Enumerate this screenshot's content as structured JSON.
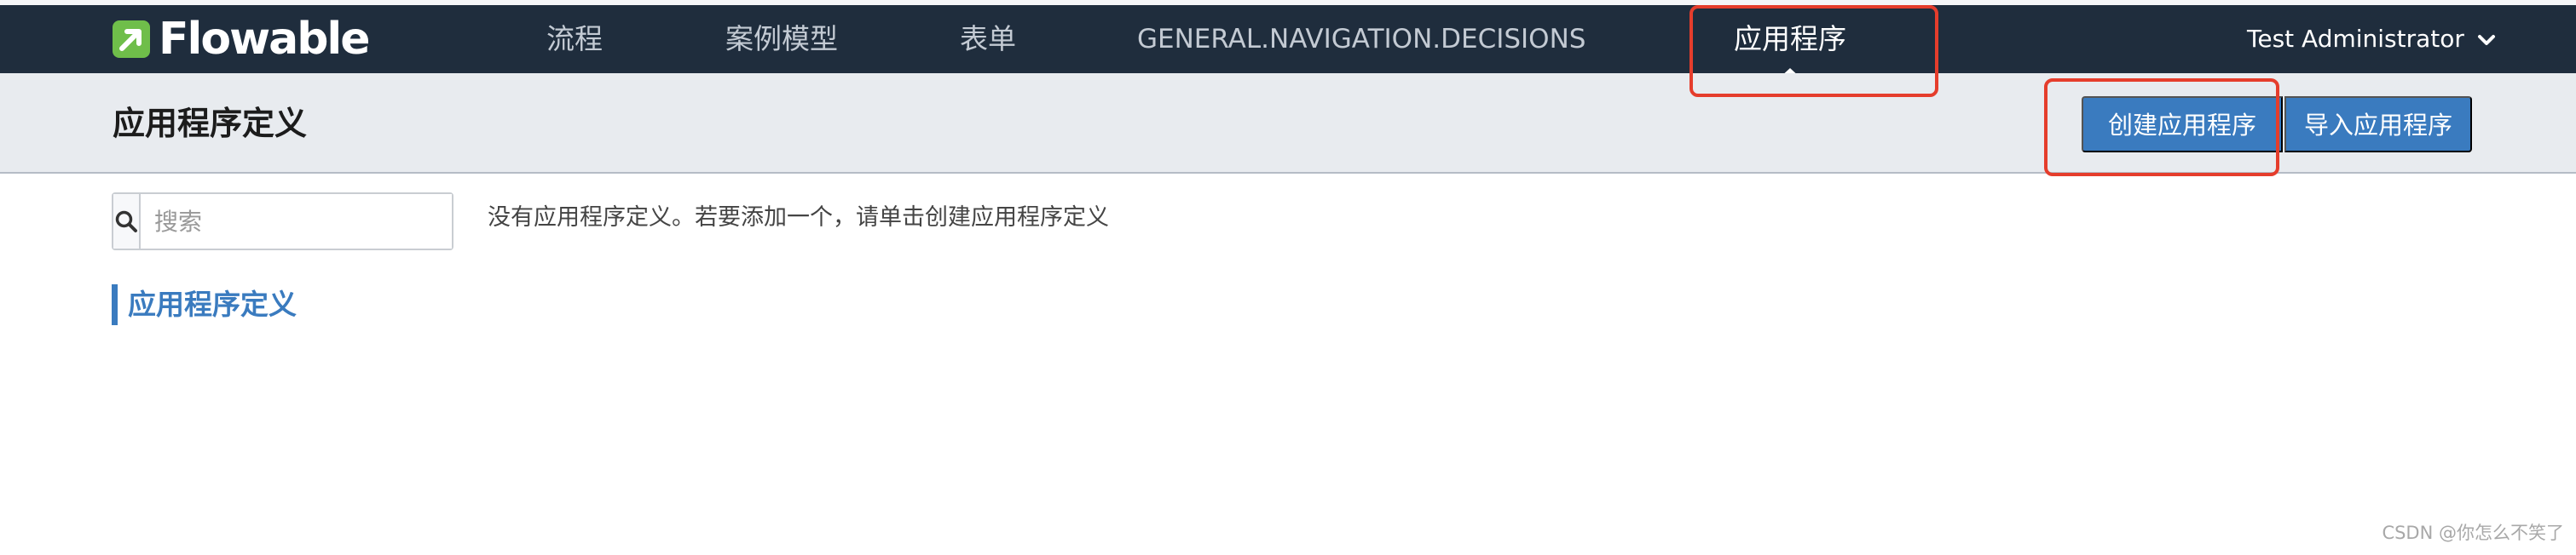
{
  "app": {
    "logo_text": "Flowable"
  },
  "nav": {
    "items": [
      {
        "label": "流程"
      },
      {
        "label": "案例模型"
      },
      {
        "label": "表单"
      },
      {
        "label": "GENERAL.NAVIGATION.DECISIONS"
      },
      {
        "label": "应用程序",
        "active": true
      }
    ],
    "user": "Test Administrator",
    "user_icon": "chevron-down-icon"
  },
  "subheader": {
    "title": "应用程序定义",
    "create_button": "创建应用程序",
    "import_button": "导入应用程序"
  },
  "search": {
    "placeholder": "搜索",
    "value": "",
    "icon": "search-icon"
  },
  "main": {
    "empty_message": "没有应用程序定义。若要添加一个，请单击创建应用程序定义",
    "section_title": "应用程序定义"
  },
  "annotations": {
    "color": "#e53d2c"
  },
  "colors": {
    "navbar": "#1f2d3d",
    "accent": "#3a7bbf",
    "logo_green": "#6fbe4a"
  },
  "watermark": "CSDN @你怎么不笑了"
}
